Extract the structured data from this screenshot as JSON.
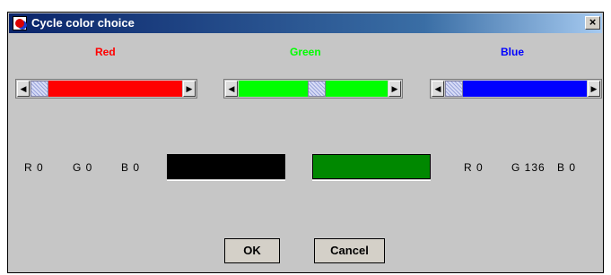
{
  "window": {
    "title": "Cycle color choice",
    "close_glyph": "×"
  },
  "labels": {
    "red": "Red",
    "green": "Green",
    "blue": "Blue"
  },
  "sliders": {
    "red": {
      "value_fraction": 0.0,
      "fill_color": "#ff0000"
    },
    "green": {
      "value_fraction": 0.53,
      "fill_color": "#00ff00"
    },
    "blue": {
      "value_fraction": 0.0,
      "fill_color": "#0000ff"
    }
  },
  "current_color": {
    "r": "R 0",
    "g": "G 0",
    "b": "B 0",
    "swatch_color": "#000000"
  },
  "new_color": {
    "r": "R 0",
    "g": "G 136",
    "b": "B 0",
    "swatch_color": "#008800"
  },
  "buttons": {
    "ok": "OK",
    "cancel": "Cancel"
  },
  "icons": {
    "left_arrow": "◀",
    "right_arrow": "▶"
  }
}
